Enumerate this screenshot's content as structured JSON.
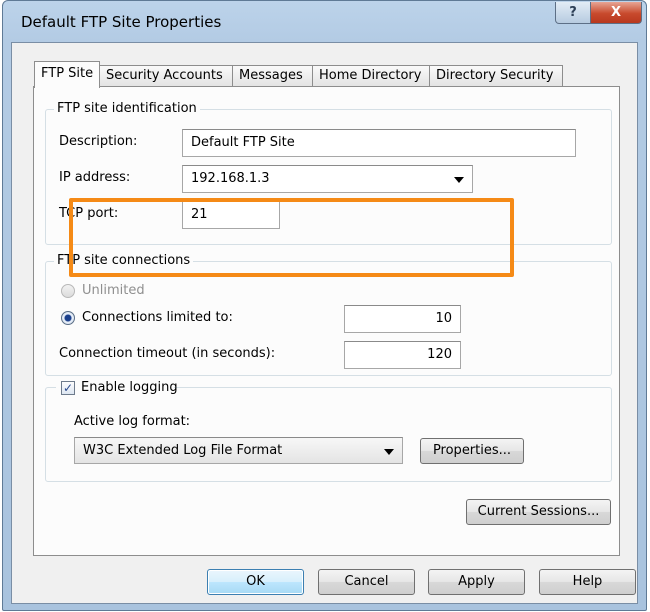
{
  "window": {
    "title": "Default FTP Site Properties",
    "help_glyph": "?",
    "close_glyph": "X"
  },
  "tabs": [
    {
      "label": "FTP Site",
      "active": true
    },
    {
      "label": "Security Accounts",
      "active": false
    },
    {
      "label": "Messages",
      "active": false
    },
    {
      "label": "Home Directory",
      "active": false
    },
    {
      "label": "Directory Security",
      "active": false
    }
  ],
  "identification": {
    "legend": "FTP site identification",
    "description_label": "Description:",
    "description_value": "Default FTP Site",
    "ip_label": "IP address:",
    "ip_value": "192.168.1.3",
    "port_label": "TCP port:",
    "port_value": "21"
  },
  "connections": {
    "legend": "FTP site connections",
    "unlimited_label": "Unlimited",
    "limited_label": "Connections limited to:",
    "limited_value": "10",
    "timeout_label": "Connection timeout (in seconds):",
    "timeout_value": "120"
  },
  "logging": {
    "enable_label": "Enable logging",
    "enabled": true,
    "format_label": "Active log format:",
    "format_value": "W3C Extended Log File Format",
    "properties_button": "Properties..."
  },
  "buttons": {
    "current_sessions": "Current Sessions...",
    "ok": "OK",
    "cancel": "Cancel",
    "apply": "Apply",
    "help": "Help"
  },
  "colors": {
    "highlight": "#f58a16",
    "close_button": "#c84a2d"
  },
  "icons": {
    "check": "✓"
  }
}
